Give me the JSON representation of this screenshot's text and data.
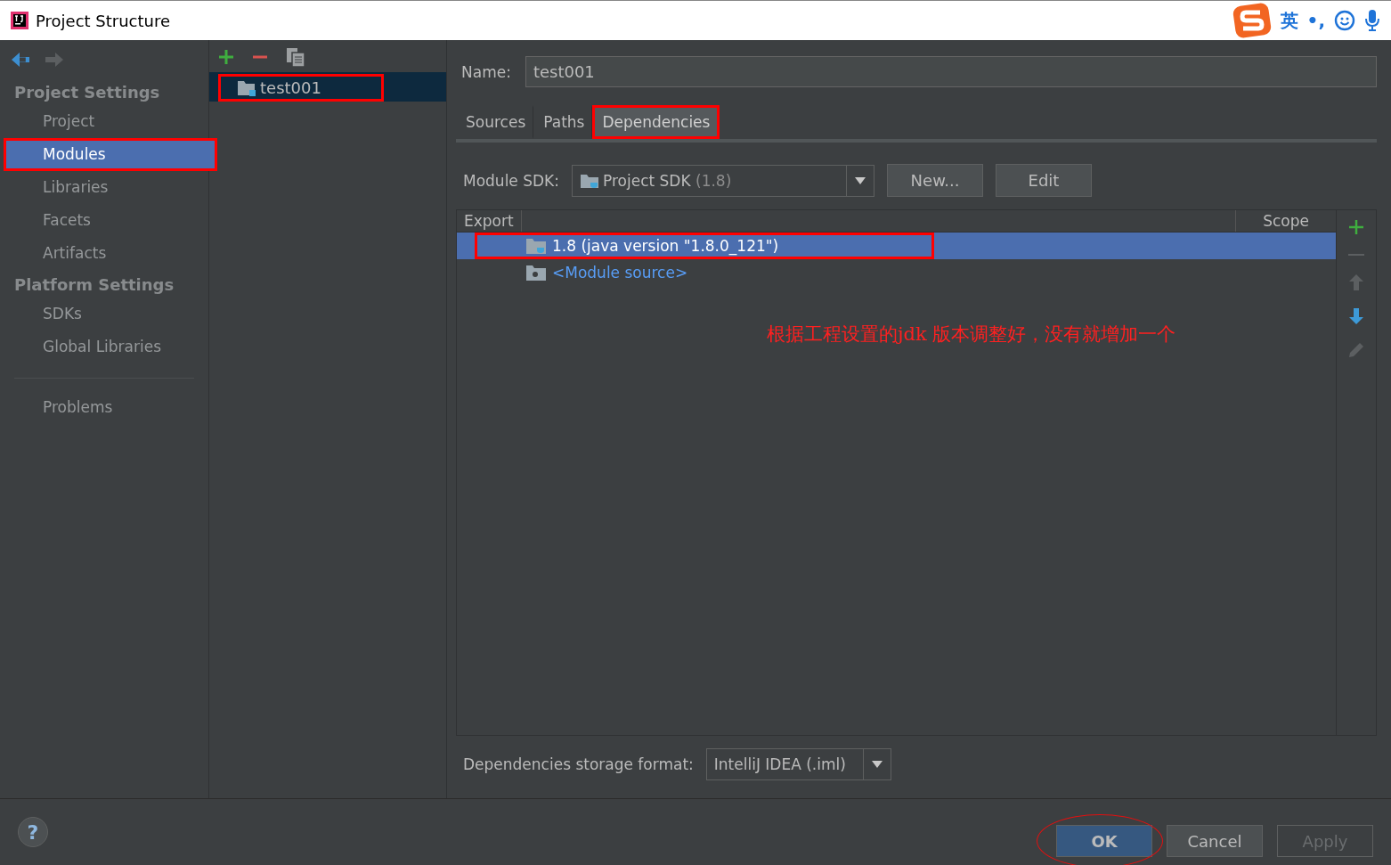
{
  "window": {
    "title": "Project Structure"
  },
  "ime": {
    "mode": "英",
    "punct": "•,"
  },
  "sidebar": {
    "sections": [
      {
        "title": "Project Settings",
        "items": [
          {
            "label": "Project",
            "selected": false,
            "highlighted": false
          },
          {
            "label": "Modules",
            "selected": true,
            "highlighted": true
          },
          {
            "label": "Libraries",
            "selected": false,
            "highlighted": false
          },
          {
            "label": "Facets",
            "selected": false,
            "highlighted": false
          },
          {
            "label": "Artifacts",
            "selected": false,
            "highlighted": false
          }
        ]
      },
      {
        "title": "Platform Settings",
        "items": [
          {
            "label": "SDKs",
            "selected": false,
            "highlighted": false
          },
          {
            "label": "Global Libraries",
            "selected": false,
            "highlighted": false
          }
        ]
      }
    ],
    "extra_items": [
      {
        "label": "Problems",
        "selected": false
      }
    ]
  },
  "modules": [
    {
      "label": "test001",
      "selected": true,
      "highlighted": true
    }
  ],
  "name_field": {
    "label": "Name:",
    "value": "test001"
  },
  "tabs": [
    {
      "label": "Sources",
      "selected": false,
      "highlighted": false
    },
    {
      "label": "Paths",
      "selected": false,
      "highlighted": false
    },
    {
      "label": "Dependencies",
      "selected": true,
      "highlighted": true
    }
  ],
  "sdk": {
    "label": "Module SDK:",
    "value": "Project SDK",
    "version": "(1.8)",
    "buttons": [
      "New...",
      "Edit"
    ]
  },
  "table": {
    "columns": [
      "Export",
      "Scope"
    ],
    "rows": [
      {
        "kind": "sdk",
        "text": "1.8 (java version \"1.8.0_121\")",
        "selected": true,
        "highlighted": true
      },
      {
        "kind": "source",
        "text": "<Module source>",
        "selected": false,
        "highlighted": false
      }
    ]
  },
  "annotation": "根据工程设置的jdk 版本调整好，没有就增加一个",
  "storage": {
    "label": "Dependencies storage format:",
    "value": "IntelliJ IDEA (.iml)"
  },
  "help": "?",
  "footer_buttons": [
    {
      "label": "OK",
      "kind": "default",
      "disabled": false,
      "circled": true
    },
    {
      "label": "Cancel",
      "kind": "normal",
      "disabled": false,
      "circled": false
    },
    {
      "label": "Apply",
      "kind": "normal",
      "disabled": true,
      "circled": false
    }
  ]
}
